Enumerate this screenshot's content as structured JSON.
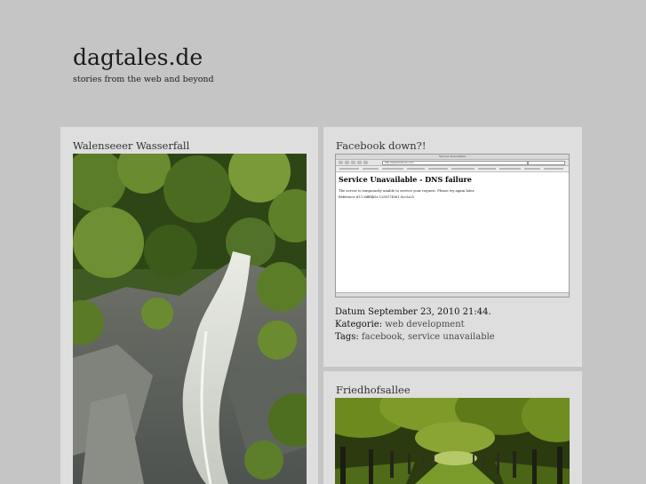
{
  "site": {
    "title": "dagtales.de",
    "tagline": "stories from the web and beyond"
  },
  "posts": [
    {
      "title": "Walenseeer Wasserfall",
      "image": "waterfall-photo"
    },
    {
      "title": "Facebook down?!",
      "image": "browser-screenshot",
      "screenshot": {
        "window_title": "Service Unavailable",
        "url": "http://www.facebook.com/",
        "error_title": "Service Unavailable - DNS failure",
        "error_message": "The server is temporarily unable to service your request. Please try again later.",
        "error_reference": "Reference #11.6dff4b5e.1285174561.0cc5a25"
      },
      "date_label": "Datum",
      "date": "September 23, 2010 21:44.",
      "category_label": "Kategorie:",
      "category": "web development",
      "tags_label": "Tags:",
      "tag1": "facebook",
      "tag_sep": ",",
      "tag2": "service unavailable"
    },
    {
      "title": "Friedhofsallee",
      "image": "tree-avenue-photo"
    }
  ],
  "colors": {
    "page_bg": "#c5c5c5",
    "card_bg": "#dedede",
    "link": "#4a4a4a"
  }
}
